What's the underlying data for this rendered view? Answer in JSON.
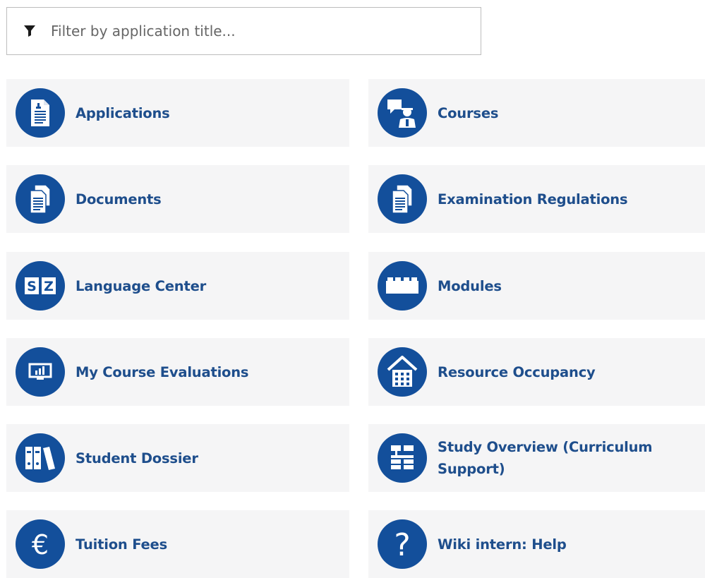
{
  "filter": {
    "placeholder": "Filter by application title...",
    "value": ""
  },
  "colors": {
    "brand": "#134f9b",
    "link": "#1e4e8c",
    "tile_bg": "#f5f5f6"
  },
  "tiles": [
    {
      "label": "Applications",
      "icon": "application-document-icon"
    },
    {
      "label": "Courses",
      "icon": "lecturer-icon"
    },
    {
      "label": "Documents",
      "icon": "documents-icon"
    },
    {
      "label": "Examination Regulations",
      "icon": "regulations-documents-icon"
    },
    {
      "label": "Language Center",
      "icon": "language-sz-icon",
      "icon_text": "SZ"
    },
    {
      "label": "Modules",
      "icon": "building-block-icon"
    },
    {
      "label": "My Course Evaluations",
      "icon": "evaluation-chart-icon"
    },
    {
      "label": "Resource Occupancy",
      "icon": "house-icon"
    },
    {
      "label": "Student Dossier",
      "icon": "binders-icon"
    },
    {
      "label": "Study Overview (Curriculum Support)",
      "icon": "curriculum-tree-icon"
    },
    {
      "label": "Tuition Fees",
      "icon": "euro-icon",
      "icon_text": "€"
    },
    {
      "label": "Wiki intern: Help",
      "icon": "help-question-icon",
      "icon_text": "?"
    }
  ]
}
